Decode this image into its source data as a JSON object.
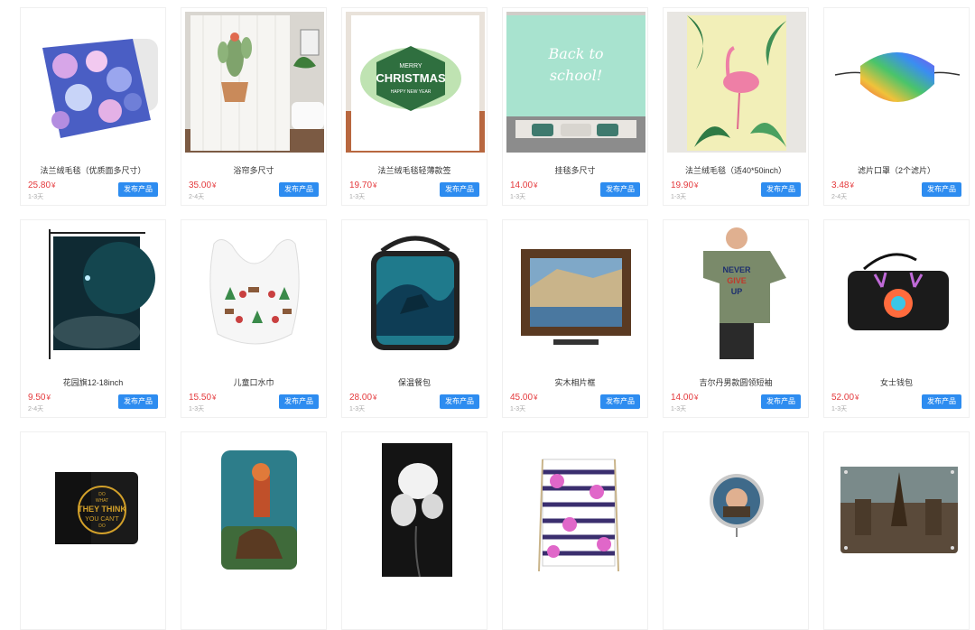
{
  "publish_label": "发布产品",
  "currency": "¥",
  "products": [
    {
      "title": "法兰绒毛毯（优质面多尺寸）",
      "price": "25.80",
      "days": "1-3天",
      "icon": "floral-blanket-icon"
    },
    {
      "title": "浴帘多尺寸",
      "price": "35.00",
      "days": "2-4天",
      "icon": "cactus-shower-curtain-icon"
    },
    {
      "title": "法兰绒毛毯轻薄款签",
      "price": "19.70",
      "days": "1-3天",
      "icon": "christmas-blanket-icon"
    },
    {
      "title": "挂毯多尺寸",
      "price": "14.00",
      "days": "1-3天",
      "icon": "back-to-school-tapestry-icon"
    },
    {
      "title": "法兰绒毛毯（适40*50inch）",
      "price": "19.90",
      "days": "1-3天",
      "icon": "flamingo-blanket-icon"
    },
    {
      "title": "滤片口罩（2个滤片）",
      "price": "3.48",
      "days": "2-4天",
      "icon": "rainbow-mask-icon"
    },
    {
      "title": "花园旗12-18inch",
      "price": "9.50",
      "days": "2-4天",
      "icon": "garden-flag-icon"
    },
    {
      "title": "儿童口水巾",
      "price": "15.50",
      "days": "1-3天",
      "icon": "baby-bib-icon"
    },
    {
      "title": "保温餐包",
      "price": "28.00",
      "days": "1-3天",
      "icon": "lunch-bag-icon"
    },
    {
      "title": "实木相片框",
      "price": "45.00",
      "days": "1-3天",
      "icon": "wood-photo-frame-icon"
    },
    {
      "title": "吉尔丹男款圆领短袖",
      "price": "14.00",
      "days": "1-3天",
      "icon": "tshirt-icon"
    },
    {
      "title": "女士钱包",
      "price": "52.00",
      "days": "1-3天",
      "icon": "wallet-clutch-icon"
    },
    {
      "title": "",
      "price": "",
      "days": "",
      "icon": "mens-wallet-icon",
      "image_text": [
        "DO",
        "WHAT",
        "THEY THINK",
        "YOU CAN'T",
        "DO"
      ]
    },
    {
      "title": "",
      "price": "",
      "days": "",
      "icon": "phone-case-icon"
    },
    {
      "title": "",
      "price": "",
      "days": "",
      "icon": "beach-towel-icon"
    },
    {
      "title": "",
      "price": "",
      "days": "",
      "icon": "drawstring-bag-icon"
    },
    {
      "title": "",
      "price": "",
      "days": "",
      "icon": "pocket-watch-icon"
    },
    {
      "title": "",
      "price": "",
      "days": "",
      "icon": "metal-sign-icon"
    }
  ],
  "image_texts": {
    "christmas": [
      "MERRY",
      "CHRISTMAS",
      "HAPPY NEW YEAR"
    ],
    "school": [
      "Back to",
      "school!"
    ],
    "tshirt": [
      "NEVER",
      "GIVE",
      "UP"
    ]
  }
}
